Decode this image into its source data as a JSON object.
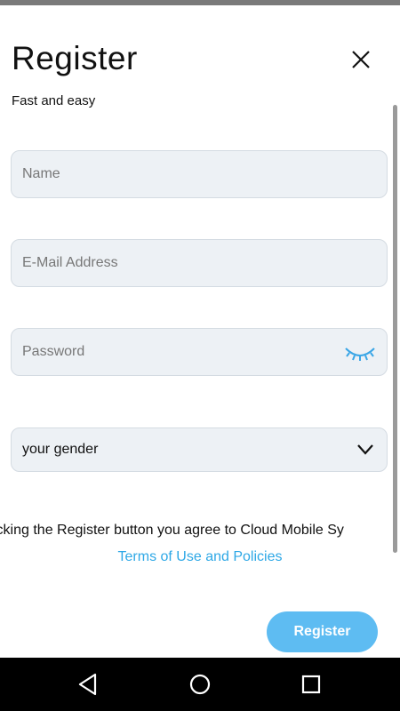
{
  "header": {
    "title": "Register",
    "subtitle": "Fast and easy"
  },
  "form": {
    "name_placeholder": "Name",
    "email_placeholder": "E-Mail Address",
    "password_placeholder": "Password",
    "gender_selected": "your gender"
  },
  "legal": {
    "agree_text": "icking the Register button you agree to Cloud Mobile Sy",
    "terms_link": "Terms of Use and Policies"
  },
  "actions": {
    "register_label": "Register"
  },
  "colors": {
    "accent": "#5ebcf2",
    "link": "#2ea8e6",
    "field_bg": "#edf1f5"
  },
  "icons": {
    "close": "close-icon",
    "eye": "eye-closed-icon",
    "chevron": "chevron-down-icon",
    "back": "nav-back-icon",
    "home": "nav-home-icon",
    "recent": "nav-recent-icon"
  }
}
